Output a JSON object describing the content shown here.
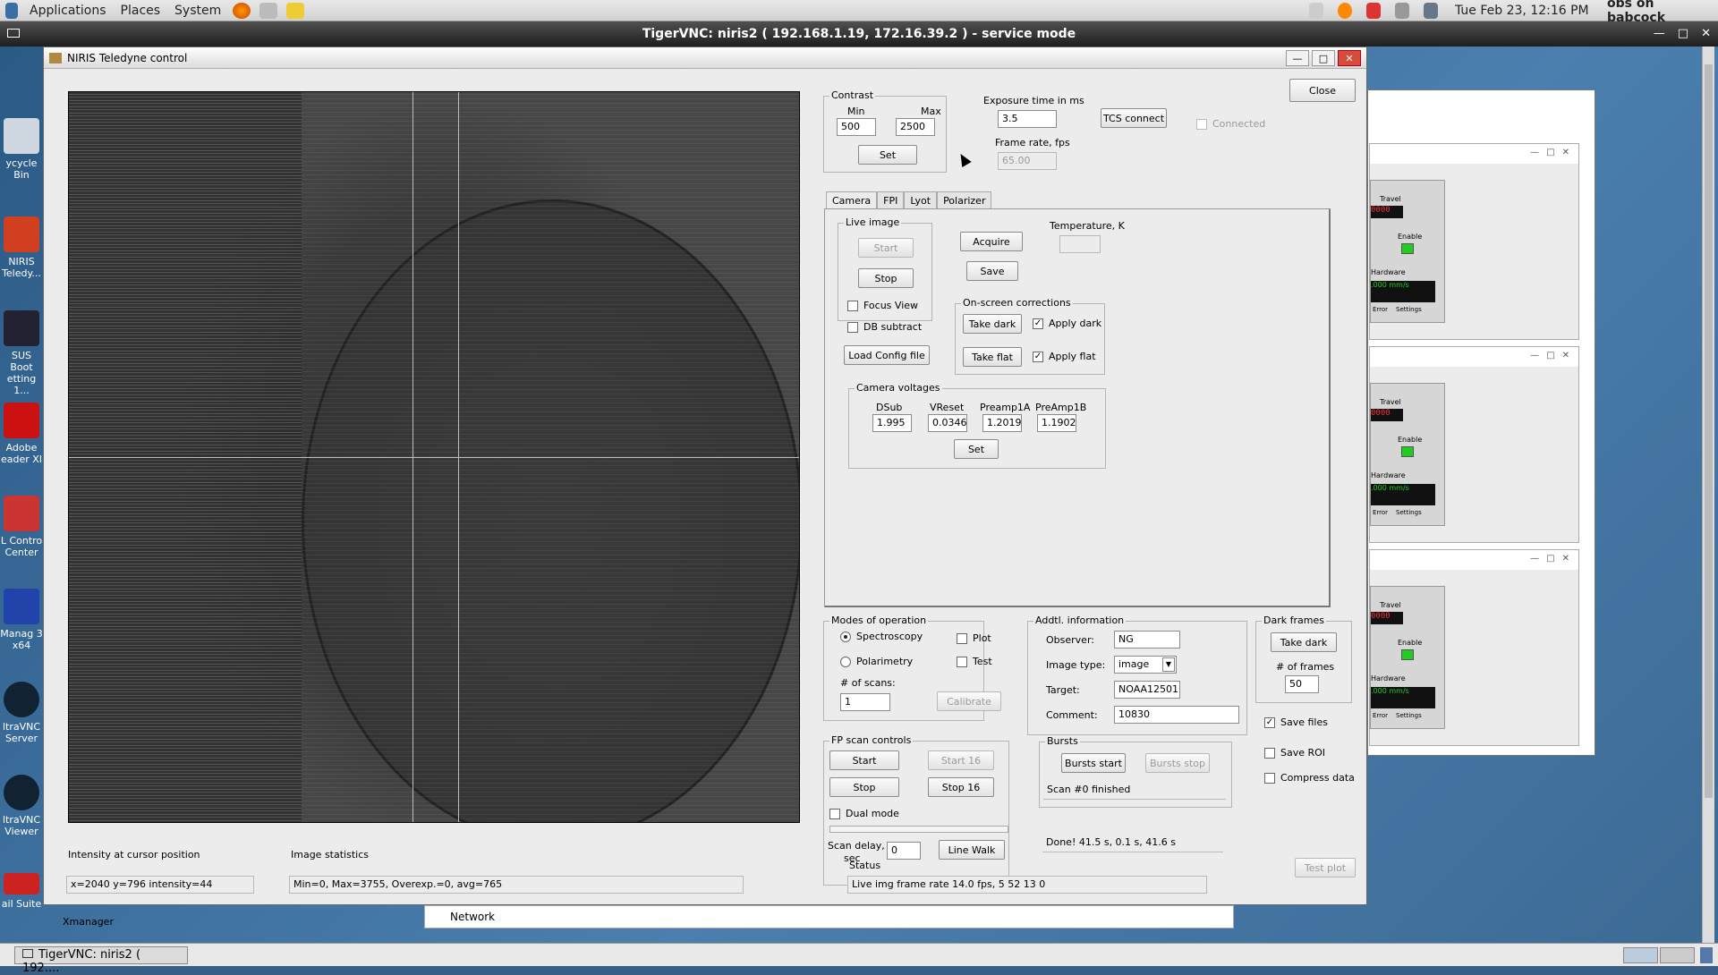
{
  "topbar": {
    "applications": "Applications",
    "places": "Places",
    "system": "System",
    "datetime": "Tue Feb 23, 12:16 PM",
    "user": "obs on babcock"
  },
  "vnc": {
    "title": "TigerVNC: niris2 ( 192.168.1.19, 172.16.39.2 ) - service mode"
  },
  "desktop_icons": [
    {
      "label": "ycycle Bin"
    },
    {
      "label": "NIRIS Teledy..."
    },
    {
      "label": "SUS Boot etting 1..."
    },
    {
      "label": "Adobe eader XI"
    },
    {
      "label": "L Contro Center"
    },
    {
      "label": "Manag 3 x64"
    },
    {
      "label": "ltraVNC Server"
    },
    {
      "label": "ltraVNC Viewer"
    },
    {
      "label": "ail Suite"
    }
  ],
  "window": {
    "title": "NIRIS Teledyne control",
    "close_label": "Close"
  },
  "contrast": {
    "legend": "Contrast",
    "min_label": "Min",
    "max_label": "Max",
    "min_value": "500",
    "max_value": "2500",
    "set_label": "Set"
  },
  "exposure": {
    "label": "Exposure time in ms",
    "value": "3.5",
    "frame_rate_label": "Frame rate, fps",
    "frame_rate_value": "65.00",
    "tcs_label": "TCS connect",
    "connected_label": "Connected"
  },
  "tabs": [
    "Camera",
    "FPI",
    "Lyot",
    "Polarizer"
  ],
  "live": {
    "legend": "Live image",
    "start": "Start",
    "stop": "Stop",
    "focus_view": "Focus View",
    "db_subtract": "DB subtract",
    "load_config": "Load Config file"
  },
  "acquire": {
    "acquire_label": "Acquire",
    "save_label": "Save",
    "temperature_label": "Temperature, K",
    "temperature_value": ""
  },
  "corrections": {
    "legend": "On-screen corrections",
    "take_dark": "Take dark",
    "apply_dark": "Apply dark",
    "take_flat": "Take flat",
    "apply_flat": "Apply flat"
  },
  "voltages": {
    "legend": "Camera voltages",
    "dsub_label": "DSub",
    "vreset_label": "VReset",
    "preamp1a_label": "Preamp1A",
    "preamp1b_label": "PreAmp1B",
    "dsub": "1.995",
    "vreset": "0.0346",
    "preamp1a": "1.2019",
    "preamp1b": "1.1902",
    "set_label": "Set"
  },
  "modes": {
    "legend": "Modes of operation",
    "spectroscopy": "Spectroscopy",
    "polarimetry": "Polarimetry",
    "plot": "Plot",
    "test": "Test",
    "scans_label": "# of scans:",
    "scans_value": "1",
    "calibrate": "Calibrate"
  },
  "addtl": {
    "legend": "Addtl. information",
    "observer_label": "Observer:",
    "observer": "NG",
    "imagetype_label": "Image type:",
    "imagetype": "image",
    "target_label": "Target:",
    "target": "NOAA12501",
    "comment_label": "Comment:",
    "comment": "10830"
  },
  "darkframes": {
    "legend": "Dark frames",
    "take_dark": "Take dark",
    "frames_label": "# of frames",
    "frames_value": "50",
    "save_files": "Save files",
    "save_roi": "Save ROI",
    "compress": "Compress data"
  },
  "fpscan": {
    "legend": "FP scan controls",
    "start": "Start",
    "start16": "Start 16",
    "stop": "Stop",
    "stop16": "Stop 16",
    "dual": "Dual mode",
    "delay_label1": "Scan delay,",
    "delay_label2": "sec",
    "delay_value": "0",
    "linewalk": "Line Walk"
  },
  "bursts": {
    "legend": "Bursts",
    "start": "Bursts start",
    "stop": "Bursts stop",
    "status": "Scan #0 finished",
    "done": "Done! 41.5 s, 0.1 s, 41.6 s"
  },
  "bottom": {
    "intensity_label": "Intensity at cursor position",
    "intensity_value": "x=2040 y=796  intensity=44",
    "stats_label": "Image statistics",
    "stats_value": "Min=0, Max=3755, Overexp.=0, avg=765",
    "status_label": "Status",
    "status_value": "Live img frame rate 14.0 fps, 5 52 13 0",
    "test_plot": "Test plot"
  },
  "taskbar": {
    "item": "TigerVNC: niris2 ( 192....",
    "network": "Network",
    "xmanager": "Xmanager"
  },
  "bg_panel": {
    "travel": "Travel",
    "enable": "Enable",
    "hardware": "Hardware",
    "error": "Error",
    "settings": "Settings",
    "led": "0000",
    "speed": ".000 mm/s"
  }
}
